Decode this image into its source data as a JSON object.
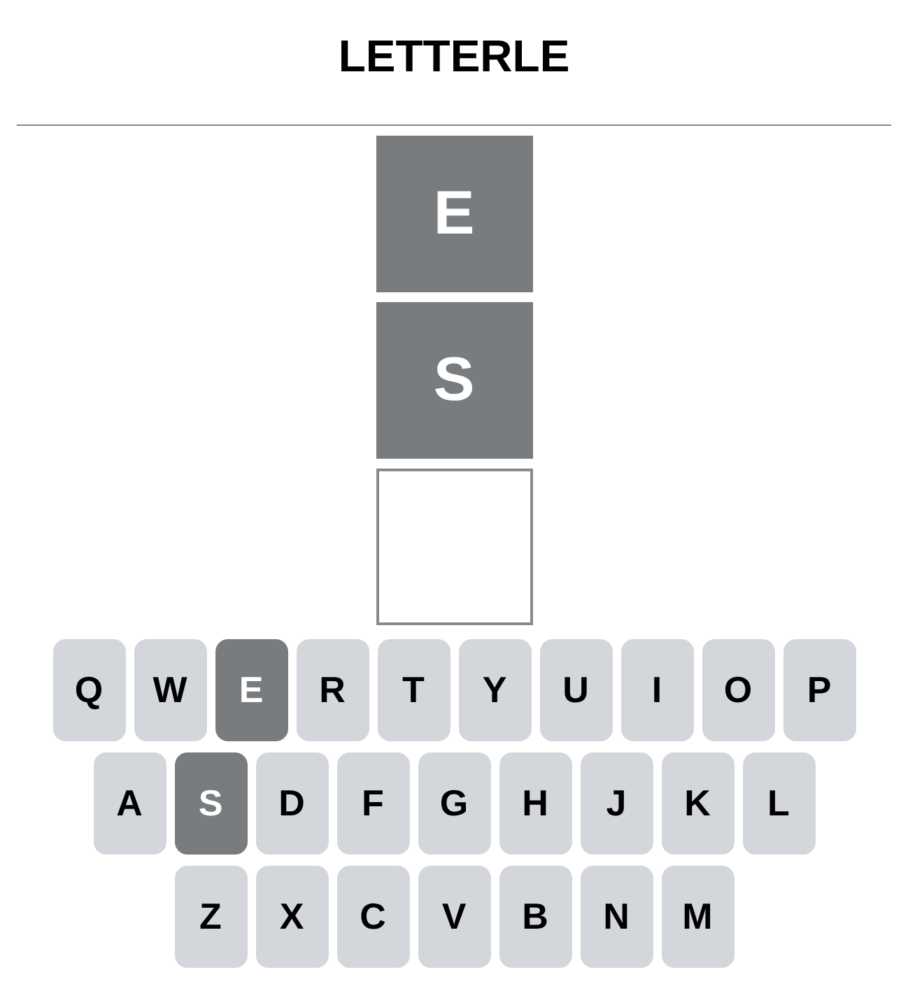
{
  "title": "LETTERLE",
  "tiles": [
    {
      "letter": "E",
      "filled": true
    },
    {
      "letter": "S",
      "filled": true
    },
    {
      "filled": false
    }
  ],
  "keyboard": [
    [
      {
        "label": "Q",
        "used": false
      },
      {
        "label": "W",
        "used": false
      },
      {
        "label": "E",
        "used": true
      },
      {
        "label": "R",
        "used": false
      },
      {
        "label": "T",
        "used": false
      },
      {
        "label": "Y",
        "used": false
      },
      {
        "label": "U",
        "used": false
      },
      {
        "label": "I",
        "used": false
      },
      {
        "label": "O",
        "used": false
      },
      {
        "label": "P",
        "used": false
      }
    ],
    [
      {
        "label": "A",
        "used": false
      },
      {
        "label": "S",
        "used": true
      },
      {
        "label": "D",
        "used": false
      },
      {
        "label": "F",
        "used": false
      },
      {
        "label": "G",
        "used": false
      },
      {
        "label": "H",
        "used": false
      },
      {
        "label": "J",
        "used": false
      },
      {
        "label": "K",
        "used": false
      },
      {
        "label": "L",
        "used": false
      }
    ],
    [
      {
        "label": "Z",
        "used": false
      },
      {
        "label": "X",
        "used": false
      },
      {
        "label": "C",
        "used": false
      },
      {
        "label": "V",
        "used": false
      },
      {
        "label": "B",
        "used": false
      },
      {
        "label": "N",
        "used": false
      },
      {
        "label": "M",
        "used": false
      }
    ]
  ]
}
